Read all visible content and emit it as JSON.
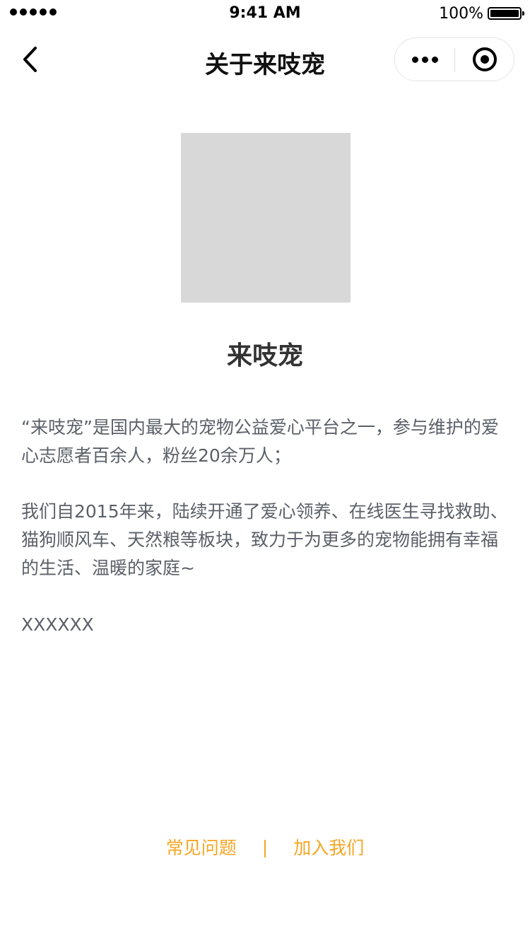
{
  "status_bar": {
    "time": "9:41 AM",
    "battery_percent": "100%"
  },
  "nav": {
    "title": "关于来吱宠",
    "back_icon": "chevron-left-icon",
    "more_icon": "more-dots-icon",
    "close_icon": "target-circle-icon"
  },
  "main": {
    "app_name": "来吱宠",
    "paragraphs": [
      "“来吱宠”是国内最大的宠物公益爱心平台之一，参与维护的爱心志愿者百余人，粉丝20余万人；",
      "我们自2015年来，陆续开通了爱心领养、在线医生寻找救助、猫狗顺风车、天然粮等板块，致力于为更多的宠物能拥有幸福的生活、温暖的家庭~",
      "XXXXXX"
    ]
  },
  "footer": {
    "faq_label": "常见问题",
    "separator": "|",
    "join_label": "加入我们"
  },
  "colors": {
    "accent": "#f5a623",
    "text": "#5b6068",
    "logo_placeholder": "#d8d8d8"
  }
}
